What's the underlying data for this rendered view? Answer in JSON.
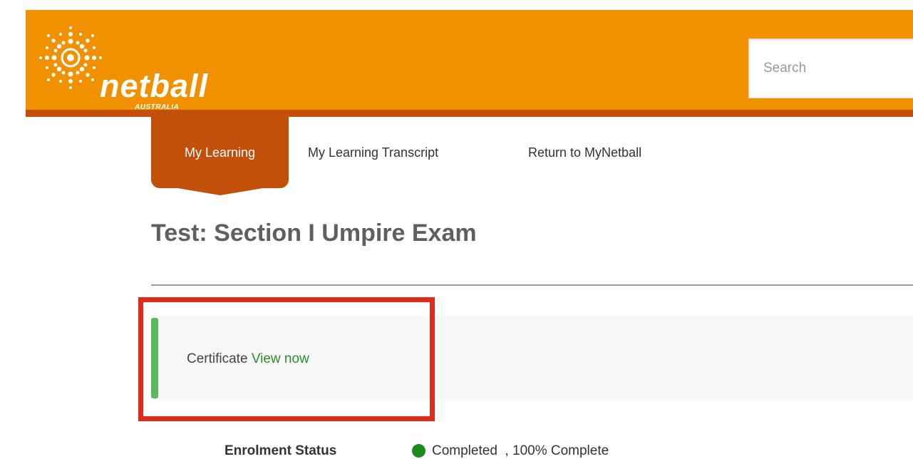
{
  "header": {
    "logo_text": "netball",
    "logo_subtext": "AUSTRALIA",
    "logo_icon": "sunburst-logo-icon",
    "search_placeholder": "Search",
    "brand_color": "#f29100",
    "band_color": "#c24f0a"
  },
  "nav": {
    "tabs": [
      {
        "label": "My Learning",
        "active": true
      },
      {
        "label": "My Learning Transcript",
        "active": false
      },
      {
        "label": "Return to MyNetball",
        "active": false
      }
    ]
  },
  "page": {
    "title": "Test: Section I Umpire Exam"
  },
  "certificate": {
    "label": "Certificate",
    "link_text": "View now",
    "accent_color": "#5cb85c"
  },
  "enrolment": {
    "label": "Enrolment Status",
    "status": "Completed",
    "progress_text": "  , 100% Complete",
    "status_color": "#1b8a1b"
  }
}
